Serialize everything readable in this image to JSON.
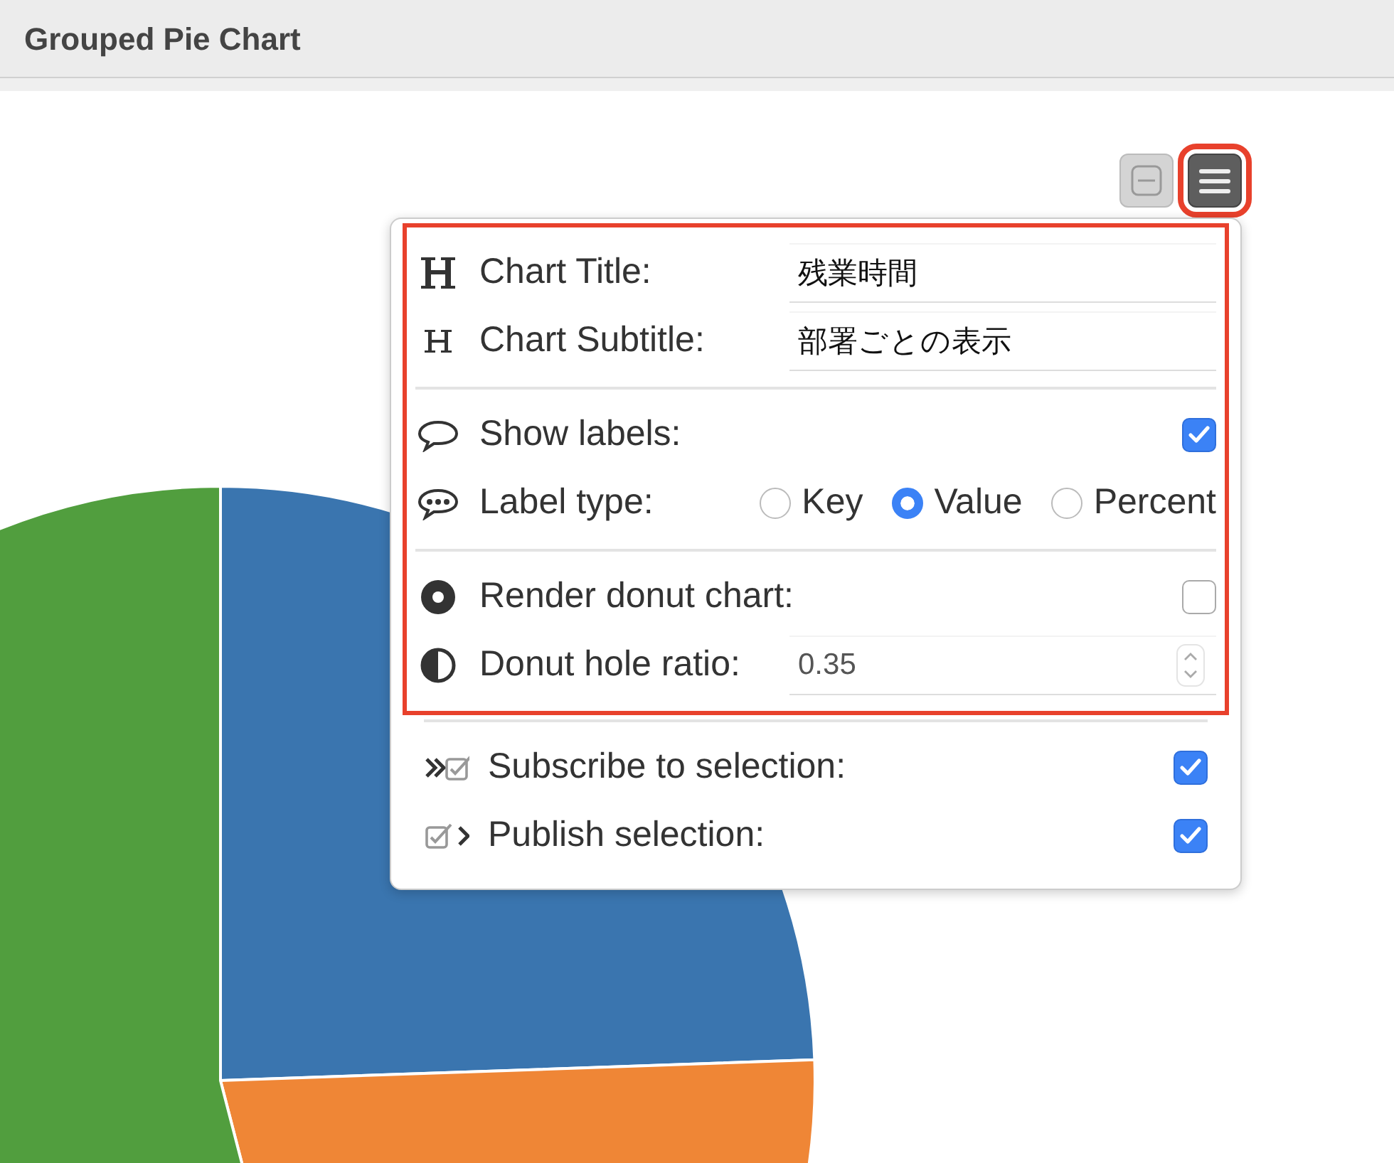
{
  "header": {
    "title": "Grouped Pie Chart"
  },
  "toolbar": [
    {
      "kind": "minimize",
      "highlighted": false
    },
    {
      "kind": "menu",
      "highlighted": true
    }
  ],
  "settings_menu": {
    "sections": [
      {
        "highlighted": true,
        "groups": [
          [
            {
              "kind": "text",
              "label": "Chart Title:",
              "value": "残業時間"
            },
            {
              "kind": "text",
              "label": "Chart Subtitle:",
              "value": "部署ごとの表示"
            }
          ],
          [
            {
              "kind": "checkbox",
              "label": "Show labels:",
              "checked": true
            },
            {
              "kind": "radio",
              "label": "Label type:",
              "options": [
                {
                  "label": "Key",
                  "selected": false
                },
                {
                  "label": "Value",
                  "selected": true
                },
                {
                  "label": "Percent",
                  "selected": false
                }
              ]
            }
          ],
          [
            {
              "kind": "checkbox",
              "label": "Render donut chart:",
              "checked": false
            },
            {
              "kind": "number",
              "label": "Donut hole ratio:",
              "value": "0.35"
            }
          ]
        ]
      },
      {
        "highlighted": false,
        "groups": [
          [
            {
              "kind": "checkbox",
              "label": "Subscribe to selection:",
              "checked": true
            },
            {
              "kind": "checkbox",
              "label": "Publish selection:",
              "checked": true
            }
          ]
        ]
      }
    ]
  }
}
